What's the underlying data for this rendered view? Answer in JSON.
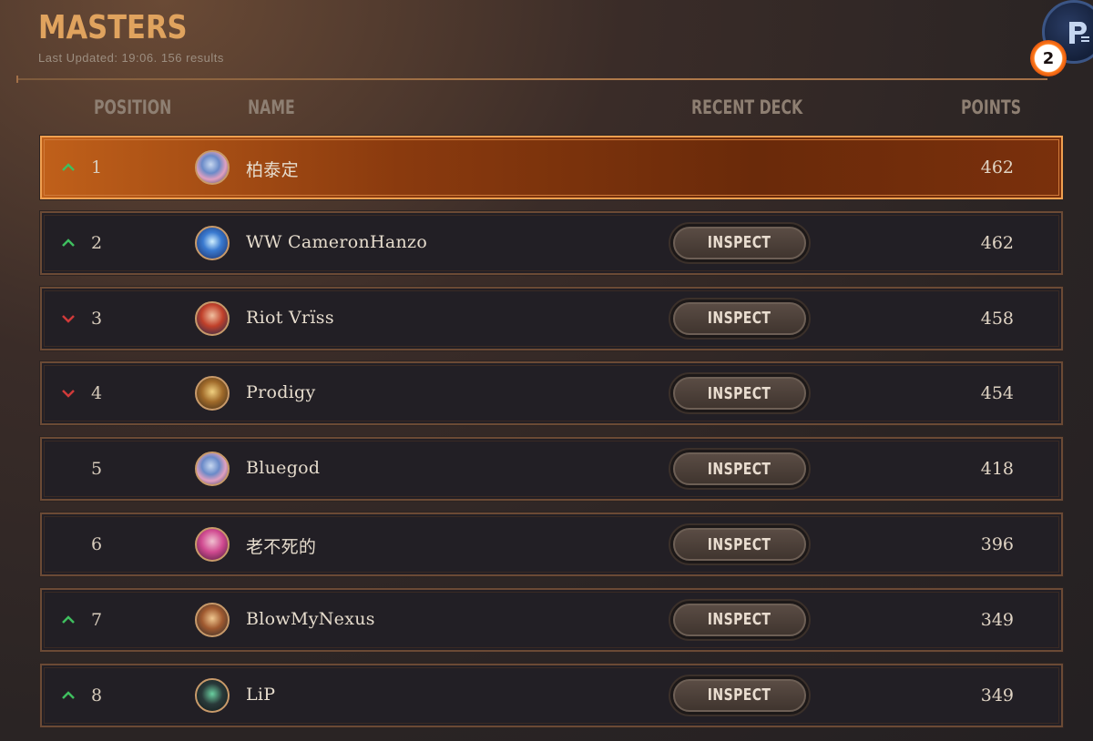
{
  "header": {
    "title": "MASTERS",
    "subtitle": "Last Updated: 19:06. 156 results",
    "notification_count": "2"
  },
  "columns": {
    "position": "POSITION",
    "name": "NAME",
    "recent_deck": "RECENT DECK",
    "points": "POINTS"
  },
  "colors": {
    "accent": "#e0a35e",
    "up": "#3fbf5f",
    "down": "#d03a3a",
    "highlight_row": "#b0541a"
  },
  "rows": [
    {
      "position": "1",
      "name": "柏泰定",
      "points": "462",
      "trend": "up",
      "inspect": null,
      "highlight": true,
      "avatar": "blue-dragon"
    },
    {
      "position": "2",
      "name": "WW CameronHanzo",
      "points": "462",
      "trend": "up",
      "inspect": "INSPECT",
      "highlight": false,
      "avatar": "blue-crystal"
    },
    {
      "position": "3",
      "name": "Riot Vrïss",
      "points": "458",
      "trend": "down",
      "inspect": "INSPECT",
      "highlight": false,
      "avatar": "red-hair"
    },
    {
      "position": "4",
      "name": "Prodigy",
      "points": "454",
      "trend": "down",
      "inspect": "INSPECT",
      "highlight": false,
      "avatar": "yordle"
    },
    {
      "position": "5",
      "name": "Bluegod",
      "points": "418",
      "trend": "none",
      "inspect": "INSPECT",
      "highlight": false,
      "avatar": "blue-dragon"
    },
    {
      "position": "6",
      "name": "老不死的",
      "points": "396",
      "trend": "none",
      "inspect": "INSPECT",
      "highlight": false,
      "avatar": "pink-hair"
    },
    {
      "position": "7",
      "name": "BlowMyNexus",
      "points": "349",
      "trend": "up",
      "inspect": "INSPECT",
      "highlight": false,
      "avatar": "warrior"
    },
    {
      "position": "8",
      "name": "LiP",
      "points": "349",
      "trend": "up",
      "inspect": "INSPECT",
      "highlight": false,
      "avatar": "dark-hero"
    }
  ]
}
